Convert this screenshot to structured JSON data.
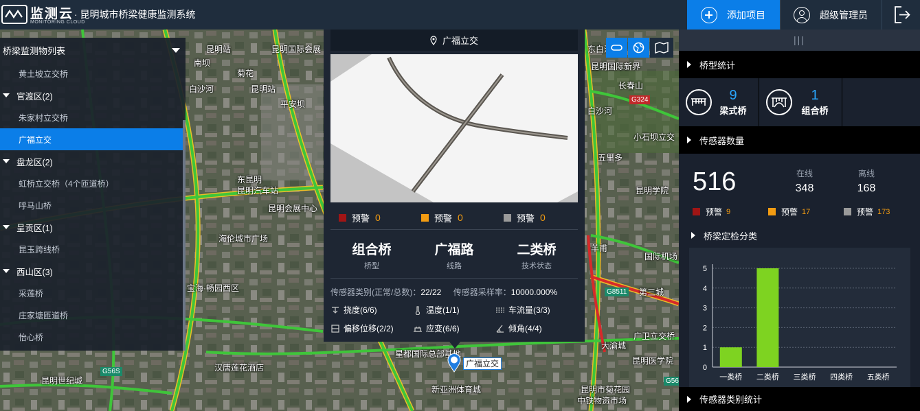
{
  "header": {
    "logo_text": "监测云",
    "logo_sub": "MONITORING CLOUD",
    "system_title": "· 昆明城市桥梁健康监测系统",
    "add_project": "添加项目",
    "user": "超级管理员"
  },
  "tree": {
    "title": "桥梁监测物列表",
    "items": [
      {
        "type": "leaf",
        "label": "黄土坡立交桥"
      },
      {
        "type": "group",
        "label": "官渡区(2)"
      },
      {
        "type": "leaf",
        "label": "朱家村立交桥"
      },
      {
        "type": "leaf",
        "label": "广福立交",
        "selected": true
      },
      {
        "type": "group",
        "label": "盘龙区(2)"
      },
      {
        "type": "leaf",
        "label": "虹桥立交桥（4个匝道桥）"
      },
      {
        "type": "leaf",
        "label": "呼马山桥"
      },
      {
        "type": "group",
        "label": "呈贡区(1)"
      },
      {
        "type": "leaf",
        "label": "昆玉跨线桥"
      },
      {
        "type": "group",
        "label": "西山区(3)"
      },
      {
        "type": "leaf",
        "label": "采莲桥"
      },
      {
        "type": "leaf",
        "label": "庄家塘匝道桥"
      },
      {
        "type": "leaf",
        "label": "怡心桥"
      }
    ]
  },
  "popup": {
    "title": "广福立交",
    "alerts": [
      {
        "label": "预警",
        "value": "0",
        "color": "#a01515"
      },
      {
        "label": "预警",
        "value": "0",
        "color": "#f39c12"
      },
      {
        "label": "预警",
        "value": "0",
        "color": "#9a9a9a"
      }
    ],
    "info": [
      {
        "value": "组合桥",
        "label": "桥型"
      },
      {
        "value": "广福路",
        "label": "线路"
      },
      {
        "value": "二类桥",
        "label": "技术状态"
      }
    ],
    "sensor_kind_label": "传感器类别(正常/总数)：",
    "sensor_kind_value": "22/22",
    "sample_rate_label": "传感器采样率：",
    "sample_rate_value": "10000.000%",
    "sensors": [
      {
        "label": "挠度(6/6)",
        "icon": "deflection-icon"
      },
      {
        "label": "温度(1/1)",
        "icon": "temperature-icon"
      },
      {
        "label": "车流量(3/3)",
        "icon": "traffic-icon"
      },
      {
        "label": "偏移位移(2/2)",
        "icon": "displacement-icon"
      },
      {
        "label": "应变(6/6)",
        "icon": "strain-icon"
      },
      {
        "label": "倾角(4/4)",
        "icon": "tilt-icon"
      }
    ]
  },
  "map": {
    "marker_label": "广福立交",
    "labels": [
      "昆明站",
      "昆明国际会展",
      "南坝",
      "菊花",
      "白沙河",
      "昆明站",
      "平安坝",
      "东白沙",
      "昆明国际新界",
      "长春山",
      "白沙河",
      "小石坝立交",
      "五里多",
      "昆明学院",
      "东昆明",
      "昆明汽车站",
      "昆明会展中心",
      "海伦城市广场",
      "羊甫",
      "国际机场",
      "星都国际总部基地",
      "大渝城",
      "广卫立交桥",
      "昆明世纪城",
      "汉唐莲花酒店",
      "新亚洲体育城",
      "昆明市菊花园",
      "中铁物资市场",
      "宝海·畅园西区",
      "第三城",
      "昆明医学院"
    ],
    "highways": [
      "G56S",
      "G8511",
      "G324",
      "G56"
    ]
  },
  "right_panel": {
    "bridge_type_title": "桥型统计",
    "bridge_types": [
      {
        "count": "9",
        "label": "梁式桥",
        "icon": "beam-bridge-icon"
      },
      {
        "count": "1",
        "label": "组合桥",
        "icon": "arch-bridge-icon"
      }
    ],
    "sensor_count_title": "传感器数量",
    "sensor_total": "516",
    "online_label": "在线",
    "online": "348",
    "offline_label": "离线",
    "offline": "168",
    "sensor_alerts": [
      {
        "label": "预警",
        "value": "9",
        "color": "#a01515"
      },
      {
        "label": "预警",
        "value": "17",
        "color": "#f39c12"
      },
      {
        "label": "预警",
        "value": "173",
        "color": "#9a9a9a"
      }
    ],
    "inspection_title": "桥梁定检分类",
    "sensor_type_title": "传感器类别统计"
  },
  "chart_data": {
    "type": "bar",
    "categories": [
      "一类桥",
      "二类桥",
      "三类桥",
      "四类桥",
      "五类桥"
    ],
    "values": [
      1,
      5,
      0,
      0,
      0
    ],
    "ylim": [
      0,
      5
    ],
    "yticks": [
      0,
      1,
      2,
      3,
      4,
      5
    ],
    "bar_color": "#7ed321",
    "grid": true
  }
}
